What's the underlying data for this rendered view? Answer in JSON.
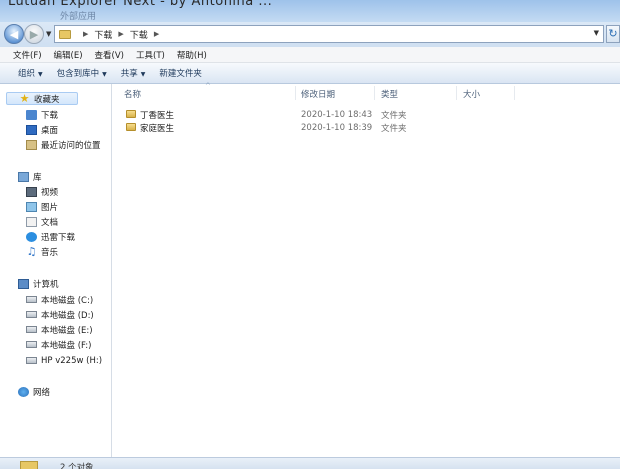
{
  "window": {
    "title": "Lutuan Explorer Next - by Antonina ...",
    "subtitle": "外部应用"
  },
  "address": {
    "crumbs": [
      "下载",
      "下载"
    ]
  },
  "menu": [
    "文件(F)",
    "编辑(E)",
    "查看(V)",
    "工具(T)",
    "帮助(H)"
  ],
  "toolbar": {
    "organize": "组织",
    "include_library": "包含到库中",
    "share": "共享",
    "new_folder": "新建文件夹"
  },
  "navigation": {
    "favorites": {
      "label": "收藏夹",
      "items": [
        "下载",
        "桌面",
        "最近访问的位置"
      ]
    },
    "libraries": {
      "label": "库",
      "items": [
        "视频",
        "图片",
        "文档",
        "迅雷下载",
        "音乐"
      ]
    },
    "computer": {
      "label": "计算机",
      "items": [
        "本地磁盘 (C:)",
        "本地磁盘 (D:)",
        "本地磁盘 (E:)",
        "本地磁盘 (F:)",
        "HP v225w (H:)"
      ]
    },
    "network": {
      "label": "网络"
    }
  },
  "file_list": {
    "columns": [
      "名称",
      "修改日期",
      "类型",
      "大小"
    ],
    "rows": [
      {
        "name": "丁香医生",
        "modified": "2020-1-10 18:43",
        "type": "文件夹",
        "size": ""
      },
      {
        "name": "家庭医生",
        "modified": "2020-1-10 18:39",
        "type": "文件夹",
        "size": ""
      }
    ]
  },
  "status": {
    "item_count": "2 个对象"
  }
}
